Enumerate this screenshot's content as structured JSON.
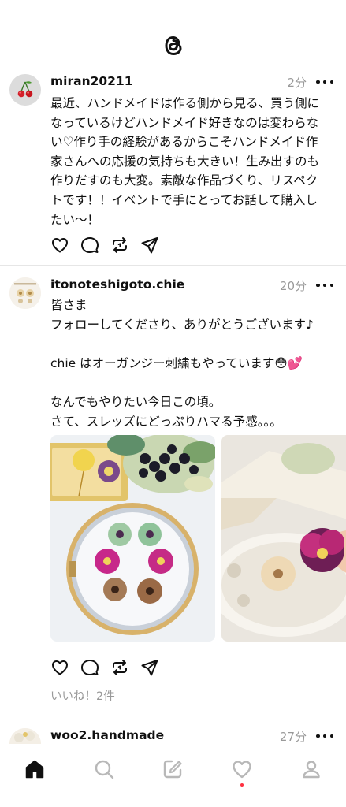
{
  "header": {
    "logo_icon": "threads-logo-icon"
  },
  "posts": [
    {
      "username": "miran20211",
      "time": "2分",
      "avatar_icon": "cherry-icon",
      "text": "最近、ハンドメイドは作る側から見る、買う側に\nなっているけどハンドメイド好きなのは変わらな\nい♡作り手の経験があるからこそハンドメイド作\n家さんへの応援の気持ちも大きい！生み出すのも\n作りだすのも大変。素敵な作品づくり、リスペク\nトです！！イベントで手にとってお話して購入し\nたい〜！"
    },
    {
      "username": "itonoteshigoto.chie",
      "time": "20分",
      "avatar_icon": "earrings-avatar-icon",
      "text": "皆さま\nフォローしてくださり、ありがとうございます♪\n\nchie はオーガンジー刺繍もやっています😳💕\n\nなんでもやりたい今日この頃。\nさて、スレッズにどっぷりハマる予感。。。",
      "likes": "いいね！2件"
    },
    {
      "username": "woo2.handmade",
      "time": "27分"
    }
  ],
  "bottom_nav": [
    {
      "name": "home-icon",
      "active": true
    },
    {
      "name": "search-icon",
      "active": false
    },
    {
      "name": "compose-icon",
      "active": false
    },
    {
      "name": "activity-heart-icon",
      "active": false,
      "dot": true
    },
    {
      "name": "profile-icon",
      "active": false
    }
  ],
  "colors": {
    "text": "#101010",
    "secondary": "#999999",
    "divider": "#e6e6e6",
    "notification": "#ff3040"
  }
}
